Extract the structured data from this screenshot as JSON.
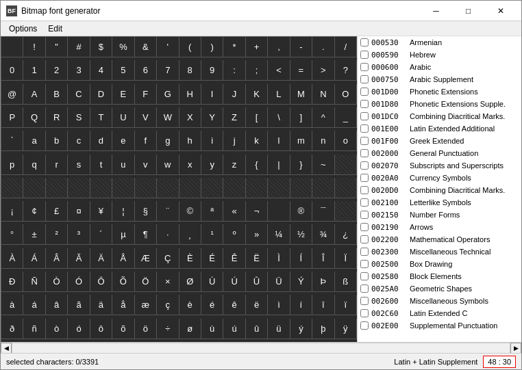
{
  "window": {
    "title": "Bitmap font generator",
    "icon": "BF"
  },
  "menu": {
    "items": [
      "Options",
      "Edit"
    ]
  },
  "grid": {
    "chars": [
      " ",
      "!",
      "\"",
      "#",
      "$",
      "%",
      "&",
      "'",
      "(",
      ")",
      "*",
      "+",
      ",",
      "-",
      ".",
      "/",
      "0",
      "1",
      "2",
      "3",
      "4",
      "5",
      "6",
      "7",
      "8",
      "9",
      ":",
      ";",
      "<",
      "=",
      ">",
      "?",
      "@",
      "A",
      "B",
      "C",
      "D",
      "E",
      "F",
      "G",
      "H",
      "I",
      "J",
      "K",
      "L",
      "M",
      "N",
      "O",
      "P",
      "Q",
      "R",
      "S",
      "T",
      "U",
      "V",
      "W",
      "X",
      "Y",
      "Z",
      "[",
      "\\",
      "]",
      "^",
      "_",
      "`",
      "a",
      "b",
      "c",
      "d",
      "e",
      "f",
      "g",
      "h",
      "i",
      "j",
      "k",
      "l",
      "m",
      "n",
      "o",
      "p",
      "q",
      "r",
      "s",
      "t",
      "u",
      "v",
      "w",
      "x",
      "y",
      "z",
      "{",
      "|",
      "}",
      "~",
      "",
      "",
      "",
      "",
      "",
      "",
      "",
      "",
      "",
      "",
      "",
      "",
      "",
      "",
      "",
      "",
      "",
      "¡",
      "¢",
      "£",
      "¤",
      "¥",
      "¦",
      "§",
      "¨",
      "©",
      "ª",
      "«",
      "¬",
      "­",
      "®",
      "¯",
      "",
      "°",
      "±",
      "²",
      "³",
      "´",
      "µ",
      "¶",
      "·",
      "¸",
      "¹",
      "º",
      "»",
      "¼",
      "½",
      "¾",
      "¿",
      "À",
      "Á",
      "Â",
      "Ã",
      "Ä",
      "Å",
      "Æ",
      "Ç",
      "È",
      "É",
      "Ê",
      "Ë",
      "Ì",
      "Í",
      "Î",
      "Ï",
      "Ð",
      "Ñ",
      "Ò",
      "Ó",
      "Ô",
      "Õ",
      "Ö",
      "×",
      "Ø",
      "Ù",
      "Ú",
      "Û",
      "Ü",
      "Ý",
      "Þ",
      "ß",
      "à",
      "á",
      "â",
      "ã",
      "ä",
      "å",
      "æ",
      "ç",
      "è",
      "é",
      "ê",
      "ë",
      "ì",
      "í",
      "î",
      "ï",
      "ð",
      "ñ",
      "ò",
      "ó",
      "ô",
      "õ",
      "ö",
      "÷",
      "ø",
      "ù",
      "ú",
      "û",
      "ü",
      "ý",
      "þ",
      "ÿ"
    ]
  },
  "unicode_list": [
    {
      "code": "000530",
      "name": "Armenian",
      "checked": false
    },
    {
      "code": "000590",
      "name": "Hebrew",
      "checked": false
    },
    {
      "code": "000600",
      "name": "Arabic",
      "checked": false
    },
    {
      "code": "000750",
      "name": "Arabic Supplement",
      "checked": false
    },
    {
      "code": "001D00",
      "name": "Phonetic Extensions",
      "checked": false
    },
    {
      "code": "001D80",
      "name": "Phonetic Extensions Supple.",
      "checked": false
    },
    {
      "code": "001DC0",
      "name": "Combining Diacritical Marks.",
      "checked": false
    },
    {
      "code": "001E00",
      "name": "Latin Extended Additional",
      "checked": false
    },
    {
      "code": "001F00",
      "name": "Greek Extended",
      "checked": false
    },
    {
      "code": "002000",
      "name": "General Punctuation",
      "checked": false
    },
    {
      "code": "002070",
      "name": "Subscripts and Superscripts",
      "checked": false
    },
    {
      "code": "0020A0",
      "name": "Currency Symbols",
      "checked": false
    },
    {
      "code": "0020D0",
      "name": "Combining Diacritical Marks.",
      "checked": false
    },
    {
      "code": "002100",
      "name": "Letterlike Symbols",
      "checked": false
    },
    {
      "code": "002150",
      "name": "Number Forms",
      "checked": false
    },
    {
      "code": "002190",
      "name": "Arrows",
      "checked": false
    },
    {
      "code": "002200",
      "name": "Mathematical Operators",
      "checked": false
    },
    {
      "code": "002300",
      "name": "Miscellaneous Technical",
      "checked": false
    },
    {
      "code": "002500",
      "name": "Box Drawing",
      "checked": false
    },
    {
      "code": "002580",
      "name": "Block Elements",
      "checked": false
    },
    {
      "code": "0025A0",
      "name": "Geometric Shapes",
      "checked": false
    },
    {
      "code": "002600",
      "name": "Miscellaneous Symbols",
      "checked": false
    },
    {
      "code": "002C60",
      "name": "Latin Extended C",
      "checked": false
    },
    {
      "code": "002E00",
      "name": "Supplemental Punctuation",
      "checked": false
    }
  ],
  "status": {
    "selected_chars": "selected characters: 0/3391",
    "charset_label": "Latin + Latin Supplement",
    "coords": "48 : 30"
  },
  "window_controls": {
    "minimize": "─",
    "maximize": "□",
    "close": "✕"
  }
}
